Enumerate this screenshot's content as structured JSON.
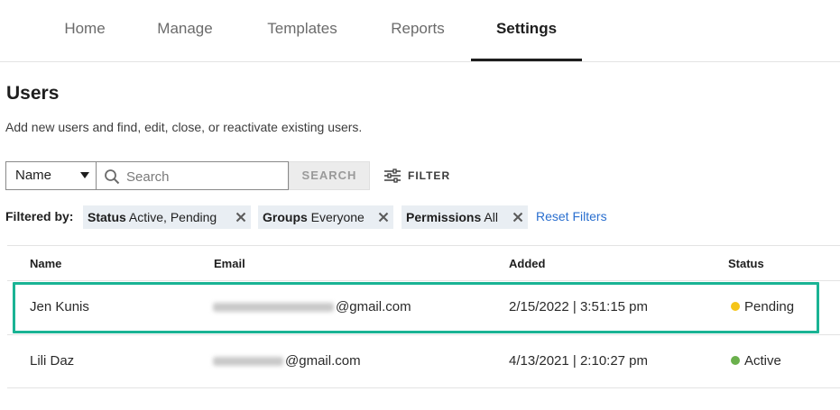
{
  "nav": {
    "tabs": [
      {
        "label": "Home"
      },
      {
        "label": "Manage"
      },
      {
        "label": "Templates"
      },
      {
        "label": "Reports"
      },
      {
        "label": "Settings"
      }
    ],
    "active": "Settings"
  },
  "page": {
    "title": "Users",
    "description": "Add new users and find, edit, close, or reactivate existing users."
  },
  "search": {
    "field_select": "Name",
    "placeholder": "Search",
    "value": "",
    "button_label": "SEARCH",
    "filter_label": "FILTER"
  },
  "filters": {
    "label": "Filtered by:",
    "chips": [
      {
        "key": "Status",
        "value": "Active, Pending"
      },
      {
        "key": "Groups",
        "value": "Everyone"
      },
      {
        "key": "Permissions",
        "value": "All"
      }
    ],
    "reset_label": "Reset Filters"
  },
  "table": {
    "headers": [
      "Name",
      "Email",
      "Added",
      "Status"
    ],
    "rows": [
      {
        "name": "Jen Kunis",
        "email_domain": "@gmail.com",
        "added": "2/15/2022 | 3:51:15 pm",
        "status": "Pending",
        "status_color": "#f5c518",
        "highlighted": true
      },
      {
        "name": "Lili Daz",
        "email_domain": "@gmail.com",
        "added": "4/13/2021 | 2:10:27 pm",
        "status": "Active",
        "status_color": "#6ab04c",
        "highlighted": false
      }
    ]
  },
  "colors": {
    "accent_link": "#2a6fcf",
    "highlight_border": "#1ab394",
    "chip_bg": "#e9eef3"
  }
}
